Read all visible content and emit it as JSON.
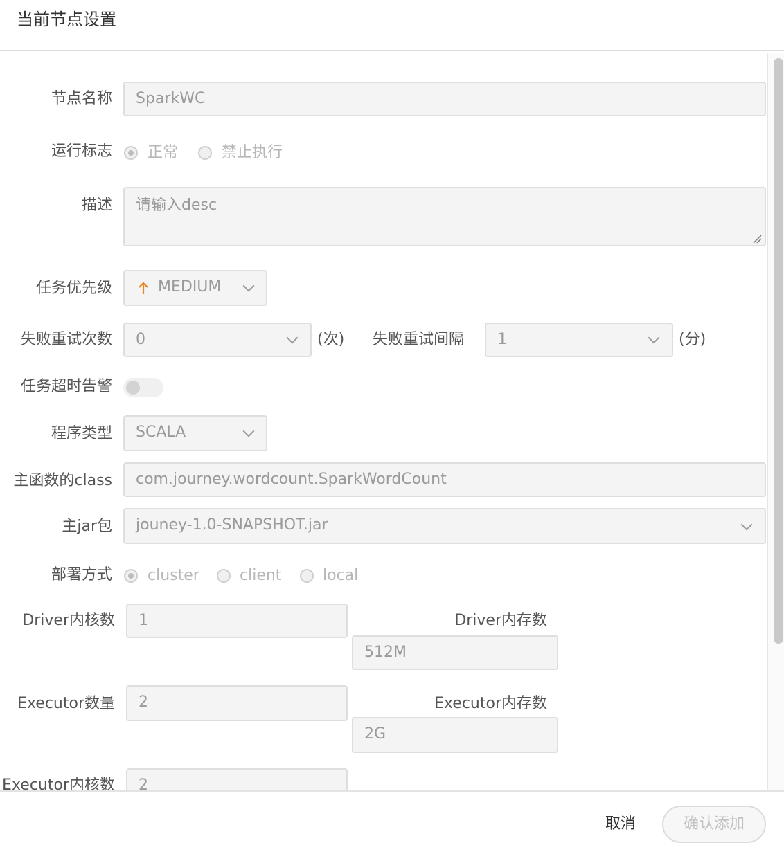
{
  "dialog": {
    "title": "当前节点设置"
  },
  "form": {
    "node_name": {
      "label": "节点名称",
      "value": "SparkWC"
    },
    "run_flag": {
      "label": "运行标志",
      "options": [
        "正常",
        "禁止执行"
      ],
      "selected": "正常"
    },
    "description": {
      "label": "描述",
      "placeholder": "请输入desc"
    },
    "priority": {
      "label": "任务优先级",
      "value": "MEDIUM",
      "icon": "arrow-up-icon"
    },
    "retry_times": {
      "label": "失败重试次数",
      "value": "0",
      "unit": "(次)"
    },
    "retry_interval": {
      "label": "失败重试间隔",
      "value": "1",
      "unit": "(分)"
    },
    "timeout_alarm": {
      "label": "任务超时告警",
      "enabled": false
    },
    "program_type": {
      "label": "程序类型",
      "value": "SCALA"
    },
    "main_class": {
      "label": "主函数的class",
      "value": "com.journey.wordcount.SparkWordCount"
    },
    "main_jar": {
      "label": "主jar包",
      "value": "jouney-1.0-SNAPSHOT.jar"
    },
    "deploy_mode": {
      "label": "部署方式",
      "options": [
        "cluster",
        "client",
        "local"
      ],
      "selected": "cluster"
    },
    "driver_cores": {
      "label": "Driver内核数",
      "value": "1"
    },
    "driver_memory": {
      "label": "Driver内存数",
      "value": "512M"
    },
    "executor_count": {
      "label": "Executor数量",
      "value": "2"
    },
    "executor_memory": {
      "label": "Executor内存数",
      "value": "2G"
    },
    "executor_cores": {
      "label": "Executor内核数",
      "value": "2"
    }
  },
  "footer": {
    "cancel_label": "取消",
    "confirm_label": "确认添加"
  },
  "colors": {
    "priority_accent": "#e8861f",
    "field_bg": "#f4f4f4",
    "border": "#dedede"
  }
}
